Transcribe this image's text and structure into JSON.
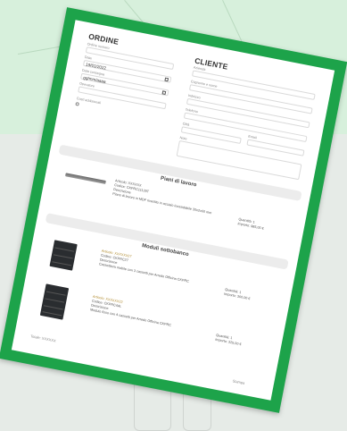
{
  "form": {
    "ordine_title": "ORDINE",
    "cliente_title": "CLIENTE",
    "ordine_fields": [
      {
        "label": "Ordine numero",
        "value": ""
      },
      {
        "label": "Data",
        "value": ""
      },
      {
        "label": "",
        "value": "19/01/2022"
      },
      {
        "label": "Data consegna",
        "value": ""
      },
      {
        "label": "",
        "value": "gg/mm/aaaa"
      },
      {
        "label": "Operatore",
        "value": ""
      },
      {
        "label": "Costi addizionali",
        "value": ""
      }
    ],
    "cliente_fields": [
      {
        "label": "Azienda",
        "value": ""
      },
      {
        "label": "Cognome e nome",
        "value": ""
      },
      {
        "label": "Indirizzo",
        "value": ""
      },
      {
        "label": "Telefono",
        "value": ""
      },
      {
        "label": "Città",
        "value": ""
      },
      {
        "label": "Email",
        "value": ""
      },
      {
        "label": "Note",
        "value": ""
      }
    ]
  },
  "sections": {
    "piani": {
      "title": "Piani di lavoro",
      "item": {
        "articolo": "Articolo: XXXXXX",
        "codice": "Codice: CKPRC11129T",
        "descrizione_label": "Descrizione",
        "descrizione": "Piano di lavoro in MDF rivestito in acciaio inossidabile 30x2x60 mm",
        "quantita": "Quantità: 1",
        "importo": "Importo: 985,00 €"
      }
    },
    "moduli": {
      "title": "Moduli sottobanco",
      "items": [
        {
          "articolo": "Articolo: XXXXXX27",
          "codice": "Codice: CKPRC27",
          "descrizione_label": "Descrizione",
          "descrizione": "Cassettiera mobile con 3 cassetti per Arredo Officina CKPRC",
          "quantita": "Quantità: 1",
          "importo": "Importo: 360,00 €"
        },
        {
          "articolo": "Articolo: XXXXXX22",
          "codice": "Codice: CKPRC4AL",
          "descrizione_label": "Descrizione",
          "descrizione": "Modulo fisso con 4 cassetti per Arredo Officina CKPRC",
          "quantita": "Quantità: 1",
          "importo": "Importo: 325,00 €"
        }
      ]
    }
  },
  "footer": {
    "left": "Totale: XXXXXX",
    "right": "Stampa"
  },
  "colors": {
    "frame": "#1da34a",
    "background_top": "#d7f0dc"
  }
}
